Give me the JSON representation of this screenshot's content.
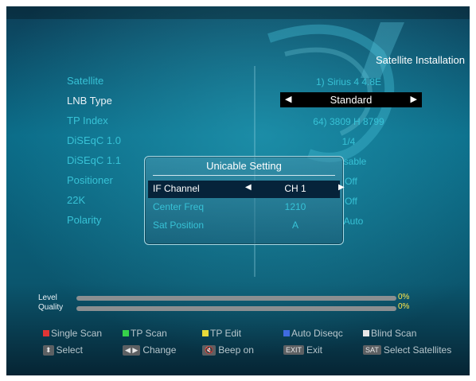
{
  "header": {
    "title": "Satellite Installation"
  },
  "settings": [
    {
      "label": "Satellite",
      "value": "1) Sirius 4 4.8E"
    },
    {
      "label": "LNB Type",
      "value": "Standard"
    },
    {
      "label": "TP Index",
      "value": "64) 3809 H 8799"
    },
    {
      "label": "DiSEqC 1.0",
      "value": "1/4"
    },
    {
      "label": "DiSEqC 1.1",
      "value": "sable"
    },
    {
      "label": "Positioner",
      "value": "Off"
    },
    {
      "label": "22K",
      "value": "Off"
    },
    {
      "label": "Polarity",
      "value": "Auto"
    }
  ],
  "lnb_arrows": {
    "left": "◀",
    "right": "▶"
  },
  "popup": {
    "title": "Unicable Setting",
    "rows": [
      {
        "label": "IF Channel",
        "value": "CH 1"
      },
      {
        "label": "Center Freq",
        "value": "1210"
      },
      {
        "label": "Sat Position",
        "value": "A"
      }
    ],
    "arrow_left": "◀",
    "arrow_right": "▶"
  },
  "signal": {
    "level_label": "Level",
    "level_value": "0%",
    "quality_label": "Quality",
    "quality_value": "0%"
  },
  "hotkeys": {
    "single_scan": "Single Scan",
    "tp_scan": "TP Scan",
    "tp_edit": "TP Edit",
    "auto_diseqc": "Auto Diseqc",
    "blind_scan": "Blind Scan",
    "select": "Select",
    "change": "Change",
    "beep_on": "Beep on",
    "exit": "Exit",
    "select_satellites": "Select Satellites",
    "key_exit": "EXIT",
    "key_sat": "SAT",
    "key_select": "⬍",
    "key_change": "◀ ▶",
    "key_mute": "🔇"
  },
  "colors": {
    "red": "#e03535",
    "green": "#36d14a",
    "yellow": "#e8d93a",
    "blue": "#3f6be0",
    "white": "#e8e8e8",
    "accent": "#37c2d6"
  }
}
